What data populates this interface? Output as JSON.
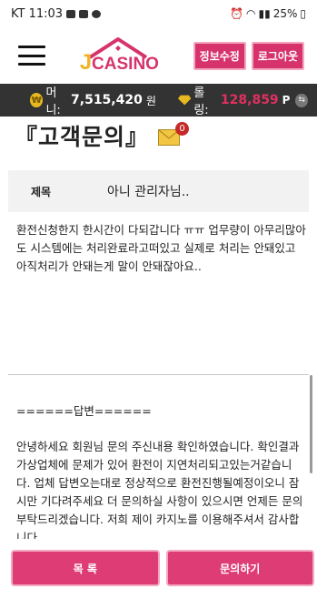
{
  "status_bar": {
    "carrier_time": "KT 11:03",
    "battery": "25%"
  },
  "header": {
    "logo_text_j": "J",
    "logo_text_rest": "CASINO",
    "edit_info_label": "정보수정",
    "logout_label": "로그아웃"
  },
  "money_bar": {
    "money_label": "머니:",
    "money_value": "7,515,420",
    "money_unit": "원",
    "rolling_label": "롤링:",
    "rolling_value": "128,859",
    "rolling_unit": "P",
    "colors": {
      "rolling": "#e03060",
      "bar_bg": "#333333"
    }
  },
  "page": {
    "title": "『고객문의』",
    "mail_badge_count": "0"
  },
  "inquiry": {
    "subject_label": "제목",
    "subject_value": "아니 관리자님..",
    "body": "환전신청한지 한시간이 다되갑니다 ㅠㅠ 업무량이 아무리많아도 시스템에는 처리완료라고떠있고 실제로 처리는 안돼있고 아직처리가 안돼는게 말이 안돼잖아요..",
    "answer_header": "======답변======",
    "answer_body": "안녕하세요 회원님 문의 주신내용 확인하였습니다. 확인결과 가상업체에 문제가 있어 환전이 지연처리되고있는거같습니다. 업체 답변오는대로 정상적으로 환전진행될예정이오니 잠시만 기다려주세요 더 문의하실 사항이 있으시면 언제든 문의 부탁드리겠습니다. 저희 제이 카지노를 이용해주셔서 감사합니다."
  },
  "buttons": {
    "list_label": "목 록",
    "inquire_label": "문의하기",
    "accent": "#de3c74"
  }
}
